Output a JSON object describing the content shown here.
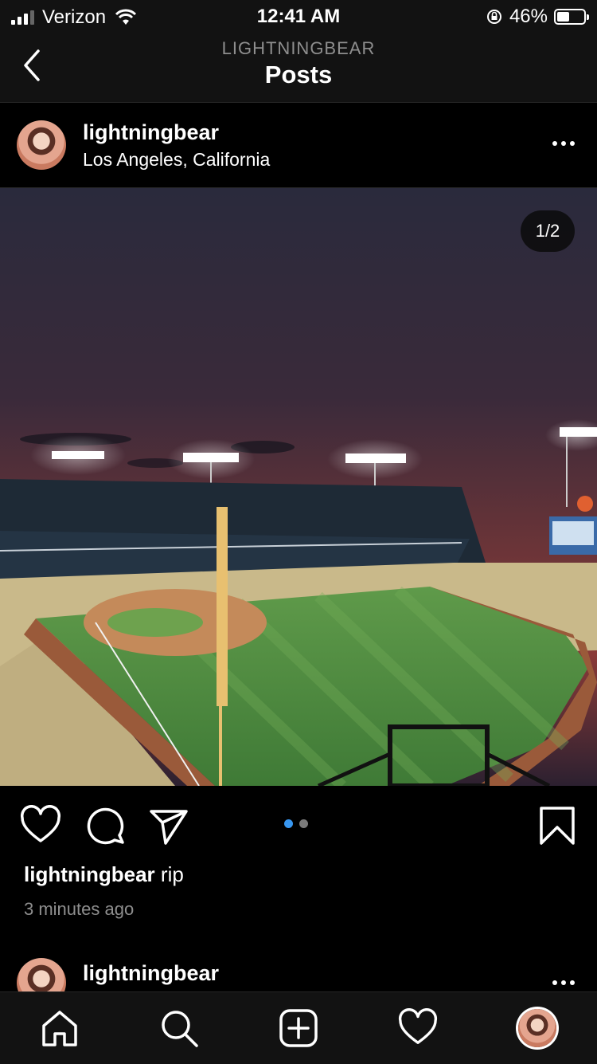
{
  "status_bar": {
    "carrier": "Verizon",
    "time": "12:41 AM",
    "battery": "46%",
    "battery_level": 0.46
  },
  "nav": {
    "subtitle": "LIGHTNINGBEAR",
    "title": "Posts"
  },
  "post": {
    "username": "lightningbear",
    "location": "Los Angeles, California",
    "image_counter": "1/2",
    "caption_text": "rip",
    "timestamp": "3 minutes ago",
    "carousel_total": 2,
    "carousel_active": 1
  },
  "next_post": {
    "username": "lightningbear"
  },
  "icons": {
    "back": "chevron-left-icon",
    "more": "more-icon",
    "like": "heart-icon",
    "comment": "comment-icon",
    "share": "send-icon",
    "save": "bookmark-icon",
    "home": "home-icon",
    "search": "search-icon",
    "new_post": "add-post-icon",
    "activity": "heart-icon",
    "profile": "avatar"
  },
  "colors": {
    "accent": "#3897f0",
    "background": "#000000",
    "bar": "#121212",
    "muted": "#8e8e8e"
  }
}
